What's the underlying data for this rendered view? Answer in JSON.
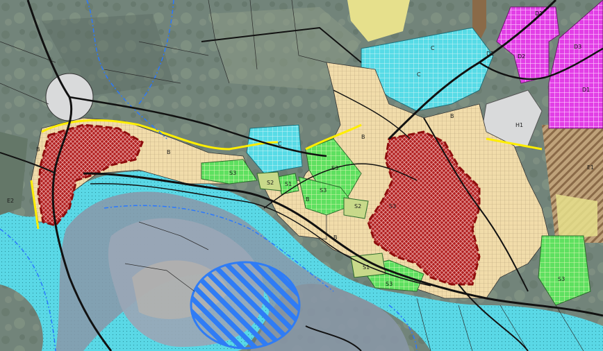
{
  "map": {
    "type": "urban zoning plan over aerial imagery",
    "colors": {
      "aerial_base": "#72847a",
      "aerial_light": "#8c9a86",
      "aerial_dark": "#5b6b62",
      "river_band_outer": "#5ad8e6",
      "river_band_inner": "#8a98a8",
      "river_channel": "#9aa6b6",
      "zone_b_residential": "#f1dcaa",
      "zone_s_park": "#5ee060",
      "zone_s2_light": "#c8d98a",
      "zone_cyan_block": "#57dbe6",
      "zone_magenta": "#e23fe6",
      "zone_historic_red": "#b01e1e",
      "zone_historic_outline": "#8e0d0d",
      "zone_grey": "#d9dadb",
      "zone_yellow_soft": "#e6e08c",
      "zone_brown_hatched": "#b09060",
      "zone_blue_hatch": "#2f7cf5",
      "border_brown": "#8a6a48",
      "border_yellow": "#ffee00",
      "roads": "#111111",
      "cadastre_lines": "#2b2b2b",
      "streams": "#2a78ff"
    },
    "labels": [
      {
        "id": "b-west",
        "text": "B"
      },
      {
        "id": "b-west-2",
        "text": "B"
      },
      {
        "id": "b-center",
        "text": "B"
      },
      {
        "id": "b-east-1",
        "text": "B"
      },
      {
        "id": "b-east-2",
        "text": "B"
      },
      {
        "id": "b-south",
        "text": "B"
      },
      {
        "id": "s3-a",
        "text": "S3"
      },
      {
        "id": "s3-b",
        "text": "S3"
      },
      {
        "id": "s3-c",
        "text": "S3"
      },
      {
        "id": "s3-d",
        "text": "S3"
      },
      {
        "id": "s3-e",
        "text": "S3"
      },
      {
        "id": "s3-east",
        "text": "S3"
      },
      {
        "id": "s2-a",
        "text": "S2"
      },
      {
        "id": "s2-b",
        "text": "S2"
      },
      {
        "id": "s1-a",
        "text": "S1"
      },
      {
        "id": "s1-b",
        "text": "S1"
      },
      {
        "id": "c-a",
        "text": "C"
      },
      {
        "id": "c-b",
        "text": "C"
      },
      {
        "id": "c-c",
        "text": "C"
      },
      {
        "id": "h1",
        "text": "H1"
      },
      {
        "id": "d1-a",
        "text": "D1"
      },
      {
        "id": "d2",
        "text": "D2"
      },
      {
        "id": "d3",
        "text": "D3"
      },
      {
        "id": "e1",
        "text": "E1"
      },
      {
        "id": "e2",
        "text": "E2"
      },
      {
        "id": "d1-b",
        "text": "D1"
      },
      {
        "id": "d1-c",
        "text": "D1"
      }
    ]
  }
}
